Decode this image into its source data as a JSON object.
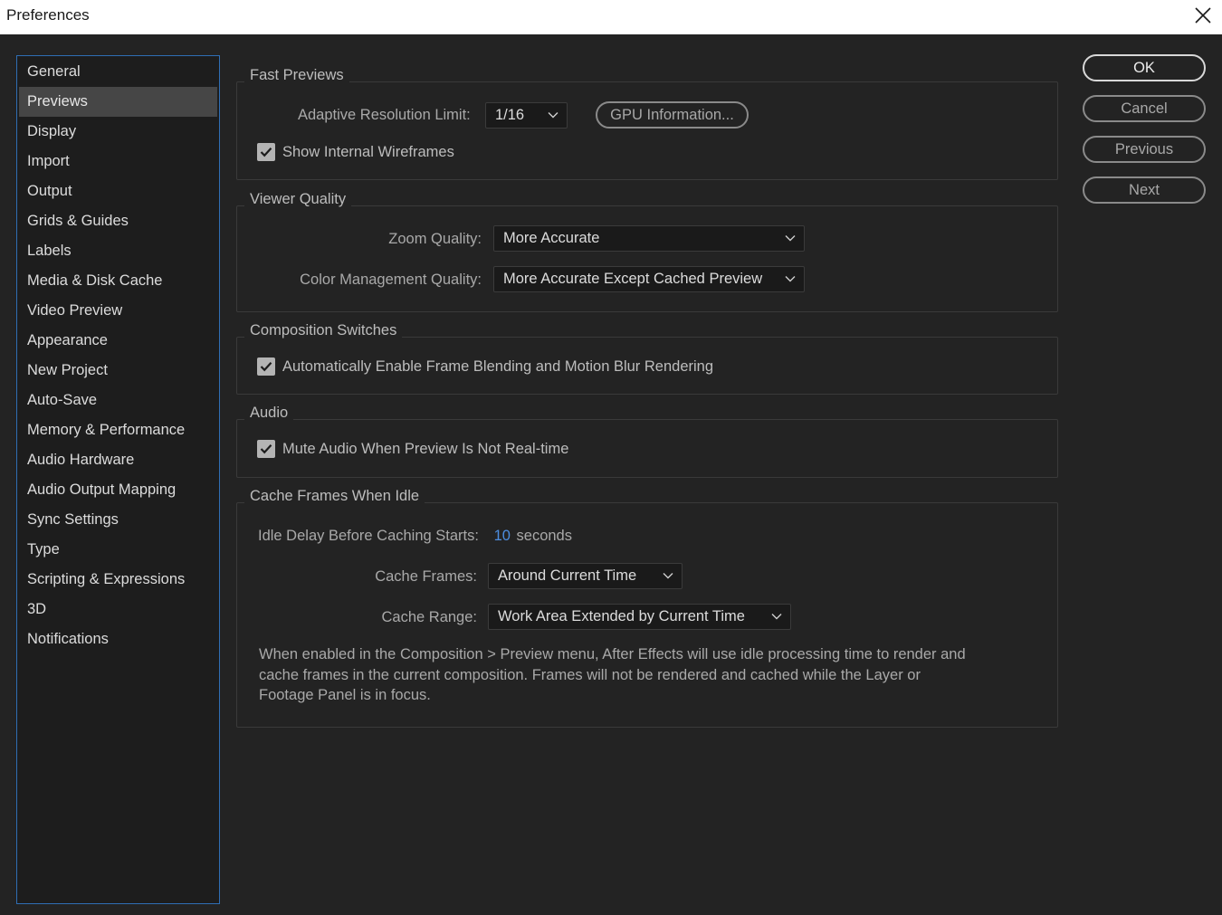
{
  "window": {
    "title": "Preferences"
  },
  "sidebar": {
    "items": [
      {
        "label": "General"
      },
      {
        "label": "Previews",
        "selected": true
      },
      {
        "label": "Display"
      },
      {
        "label": "Import"
      },
      {
        "label": "Output"
      },
      {
        "label": "Grids & Guides"
      },
      {
        "label": "Labels"
      },
      {
        "label": "Media & Disk Cache"
      },
      {
        "label": "Video Preview"
      },
      {
        "label": "Appearance"
      },
      {
        "label": "New Project"
      },
      {
        "label": "Auto-Save"
      },
      {
        "label": "Memory & Performance"
      },
      {
        "label": "Audio Hardware"
      },
      {
        "label": "Audio Output Mapping"
      },
      {
        "label": "Sync Settings"
      },
      {
        "label": "Type"
      },
      {
        "label": "Scripting & Expressions"
      },
      {
        "label": "3D"
      },
      {
        "label": "Notifications"
      }
    ]
  },
  "fast_previews": {
    "heading": "Fast Previews",
    "adaptive_label": "Adaptive Resolution Limit:",
    "adaptive_value": "1/16",
    "gpu_button": "GPU Information...",
    "wireframes_label": "Show Internal Wireframes",
    "wireframes_checked": true
  },
  "viewer_quality": {
    "heading": "Viewer Quality",
    "zoom_label": "Zoom Quality:",
    "zoom_value": "More Accurate",
    "color_label": "Color Management Quality:",
    "color_value": "More Accurate Except Cached Preview"
  },
  "composition_switches": {
    "heading": "Composition Switches",
    "blend_label": "Automatically Enable Frame Blending and Motion Blur Rendering",
    "blend_checked": true
  },
  "audio": {
    "heading": "Audio",
    "mute_label": "Mute Audio When Preview Is Not Real-time",
    "mute_checked": true
  },
  "cache_idle": {
    "heading": "Cache Frames When Idle",
    "delay_label": "Idle Delay Before Caching Starts:",
    "delay_value": "10",
    "delay_unit": "seconds",
    "frames_label": "Cache Frames:",
    "frames_value": "Around Current Time",
    "range_label": "Cache Range:",
    "range_value": "Work Area Extended by Current Time",
    "description": "When enabled in the Composition > Preview menu, After Effects will use idle processing time to render and\ncache frames in the current composition. Frames will not be rendered and cached while the Layer or\nFootage Panel is in focus."
  },
  "buttons": {
    "ok": "OK",
    "cancel": "Cancel",
    "previous": "Previous",
    "next": "Next"
  },
  "colors": {
    "background": "#232323",
    "sidebar_border": "#2f6eb4",
    "selected_item": "#464646",
    "link_value": "#4d8ee0"
  }
}
